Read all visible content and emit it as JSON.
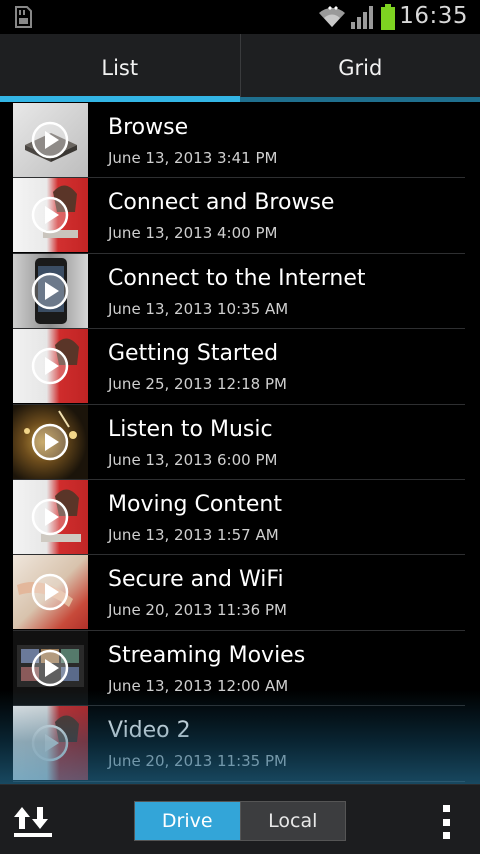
{
  "status_bar": {
    "time": "16:35",
    "icons": [
      "sd-card-icon",
      "wifi-icon",
      "signal-icon",
      "battery-icon"
    ]
  },
  "tabs": [
    {
      "label": "List",
      "active": true
    },
    {
      "label": "Grid",
      "active": false
    }
  ],
  "videos": [
    {
      "title": "Browse",
      "date": "June 13, 2013 3:41 PM"
    },
    {
      "title": "Connect and Browse",
      "date": "June 13, 2013 4:00 PM"
    },
    {
      "title": "Connect to the Internet",
      "date": "June 13, 2013 10:35 AM"
    },
    {
      "title": "Getting Started",
      "date": "June 25, 2013 12:18 PM"
    },
    {
      "title": "Listen to Music",
      "date": "June 13, 2013 6:00 PM"
    },
    {
      "title": "Moving Content",
      "date": "June 13, 2013 1:57 AM"
    },
    {
      "title": "Secure and WiFi",
      "date": "June 20, 2013 11:36 PM"
    },
    {
      "title": "Streaming Movies",
      "date": "June 13, 2013 12:00 AM"
    },
    {
      "title": "Video 2",
      "date": "June 20, 2013 11:35 PM"
    }
  ],
  "bottom_bar": {
    "sync_icon": "upload-download-icon",
    "segments": [
      {
        "label": "Drive",
        "selected": true
      },
      {
        "label": "Local",
        "selected": false
      }
    ],
    "menu_icon": "overflow-menu-icon"
  },
  "colors": {
    "accent": "#33b5e5",
    "selected_segment": "#33a5d8",
    "tab_bar": "#1e1f21"
  }
}
